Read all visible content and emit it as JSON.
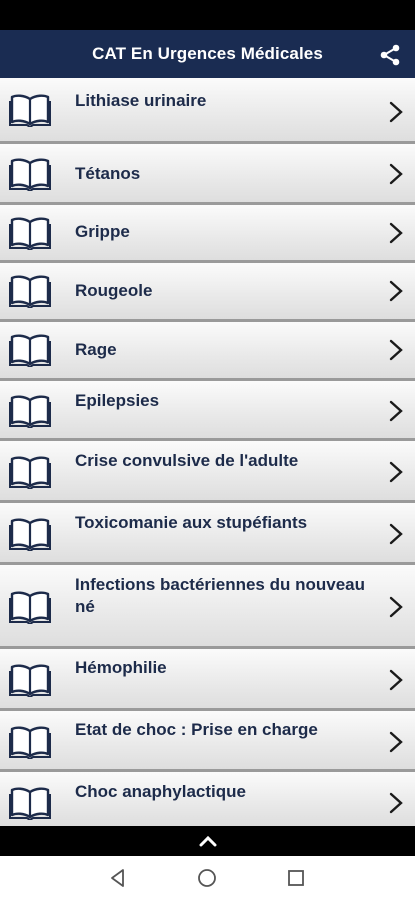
{
  "header": {
    "title": "CAT En Urgences Médicales",
    "share_icon": "share-icon"
  },
  "list": {
    "items": [
      {
        "label": "Lithiase urinaire"
      },
      {
        "label": "Tétanos"
      },
      {
        "label": "Grippe"
      },
      {
        "label": "Rougeole"
      },
      {
        "label": "Rage"
      },
      {
        "label": "Epilepsies"
      },
      {
        "label": "Crise convulsive de l'adulte"
      },
      {
        "label": "Toxicomanie aux stupéfiants"
      },
      {
        "label": "Infections bactériennes du nouveau né"
      },
      {
        "label": "Hémophilie"
      },
      {
        "label": "Etat de choc : Prise en charge"
      },
      {
        "label": "Choc anaphylactique"
      }
    ],
    "item_icon": "book-icon",
    "chevron_icon": "chevron-right-icon"
  },
  "bottom_strip": {
    "icon": "chevron-up-icon"
  },
  "nav_bar": {
    "icons": [
      "back-icon",
      "home-icon",
      "recents-icon"
    ]
  },
  "colors": {
    "app_bar": "#1a2c52",
    "label_text": "#1d2b4a",
    "row_separator": "#9a9a9a",
    "status_bar": "#000000"
  }
}
